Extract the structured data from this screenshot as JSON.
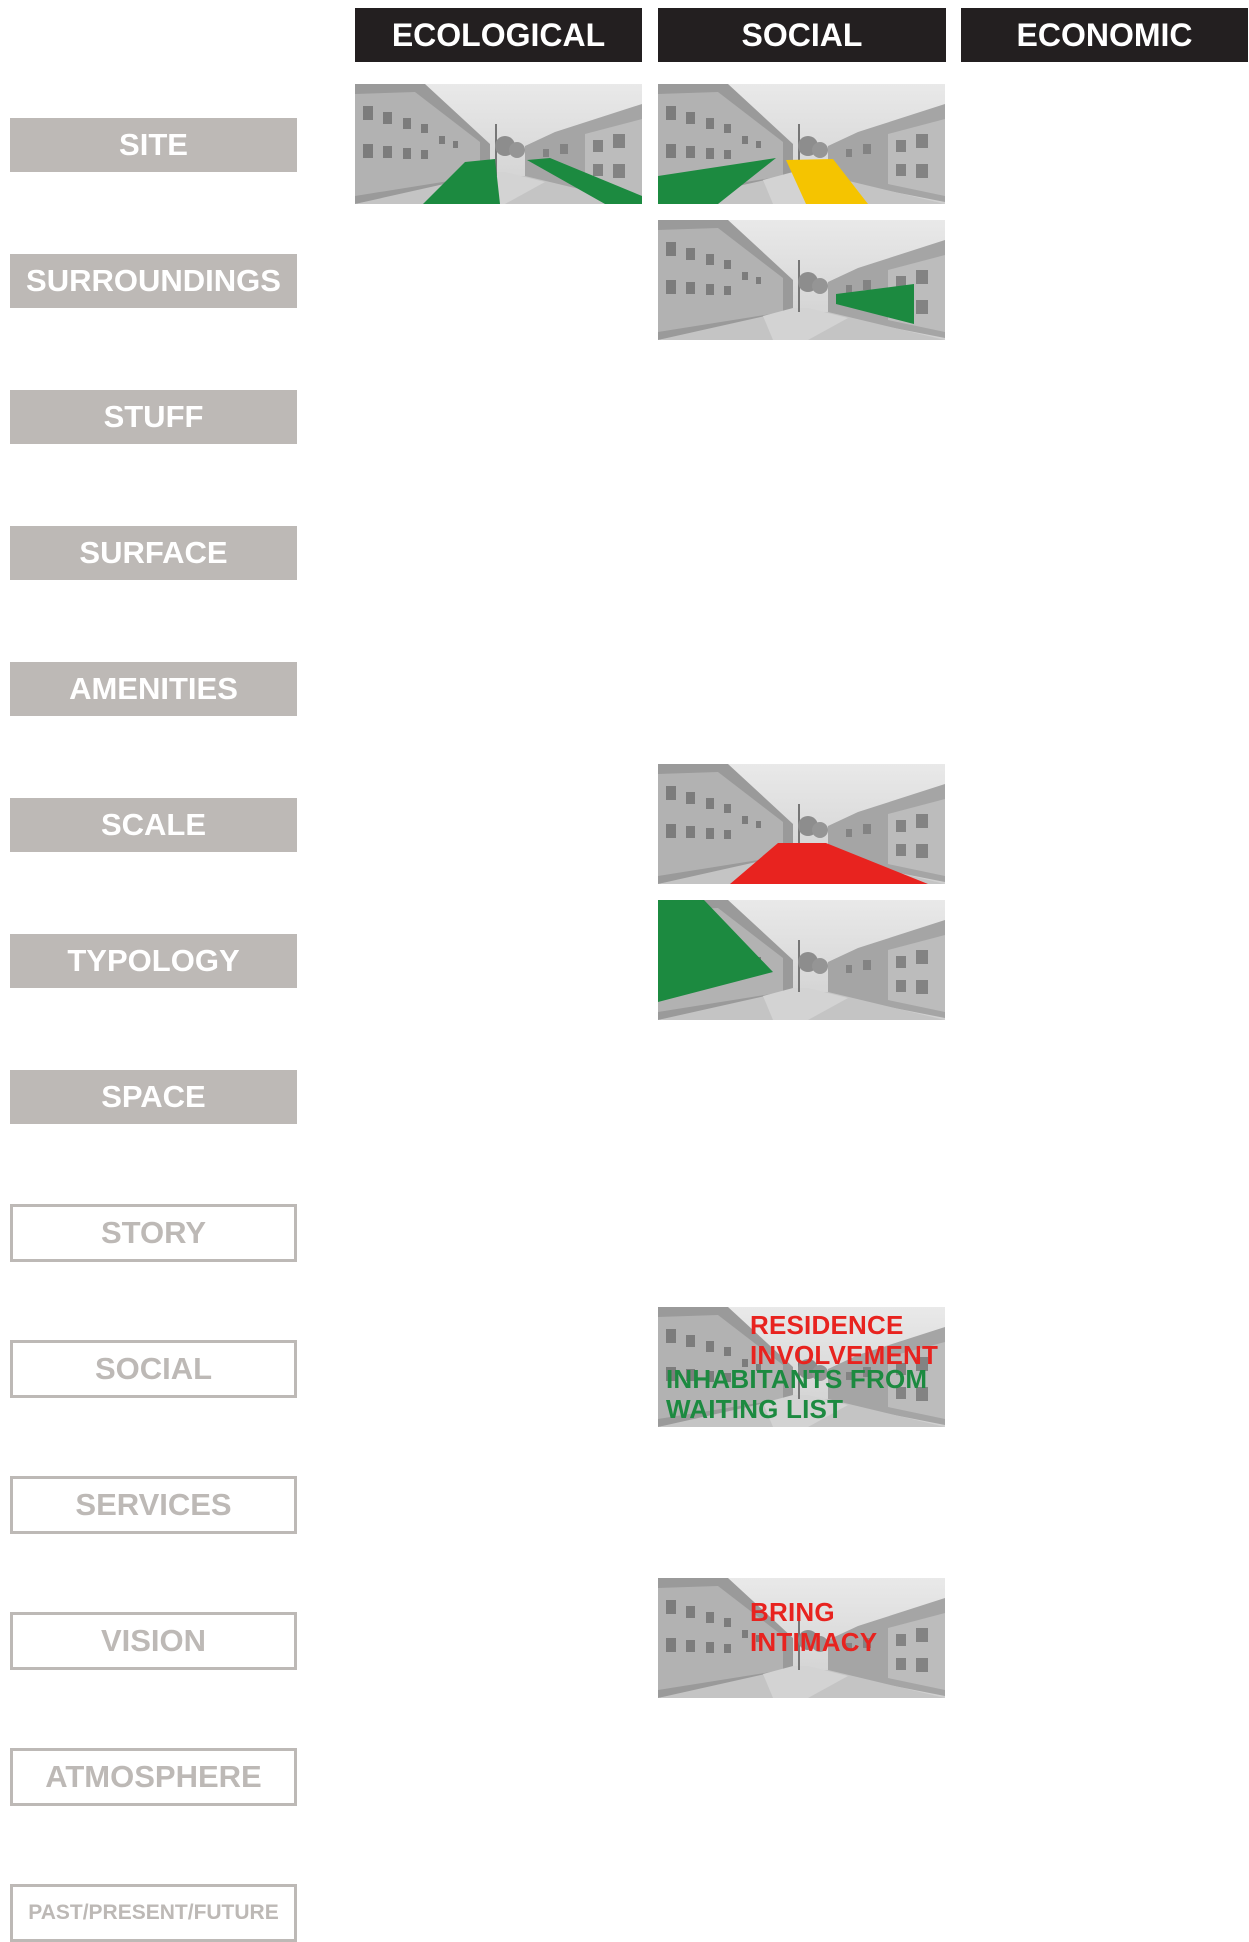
{
  "columns": [
    "ECOLOGICAL",
    "SOCIAL",
    "ECONOMIC"
  ],
  "rows": [
    {
      "label": "SITE",
      "style": "filled"
    },
    {
      "label": "SURROUNDINGS",
      "style": "filled"
    },
    {
      "label": "STUFF",
      "style": "filled"
    },
    {
      "label": "SURFACE",
      "style": "filled"
    },
    {
      "label": "AMENITIES",
      "style": "filled"
    },
    {
      "label": "SCALE",
      "style": "filled"
    },
    {
      "label": "TYPOLOGY",
      "style": "filled"
    },
    {
      "label": "SPACE",
      "style": "filled"
    },
    {
      "label": "STORY",
      "style": "outline"
    },
    {
      "label": "SOCIAL",
      "style": "outline"
    },
    {
      "label": "SERVICES",
      "style": "outline"
    },
    {
      "label": "VISION",
      "style": "outline"
    },
    {
      "label": "ATMOSPHERE",
      "style": "outline"
    },
    {
      "label": "PAST/PRESENT/FUTURE",
      "style": "outline"
    }
  ],
  "cells": {
    "social_social": {
      "lines": [
        {
          "text": "RESIDENCE",
          "color": "#e8231f"
        },
        {
          "text": "INVOLVEMENT",
          "color": "#e8231f"
        },
        {
          "text": "INHABITANTS FROM",
          "color": "#1c8a40"
        },
        {
          "text": "WAITING LIST",
          "color": "#1c8a40"
        }
      ]
    },
    "vision_social": {
      "lines": [
        {
          "text": "BRING",
          "color": "#e8231f"
        },
        {
          "text": "INTIMACY",
          "color": "#e8231f"
        }
      ]
    }
  },
  "colors": {
    "header_bg": "#231f20",
    "label_fill": "#bdb9b6",
    "green": "#1c8a40",
    "yellow": "#f5c400",
    "red": "#e8231f"
  }
}
